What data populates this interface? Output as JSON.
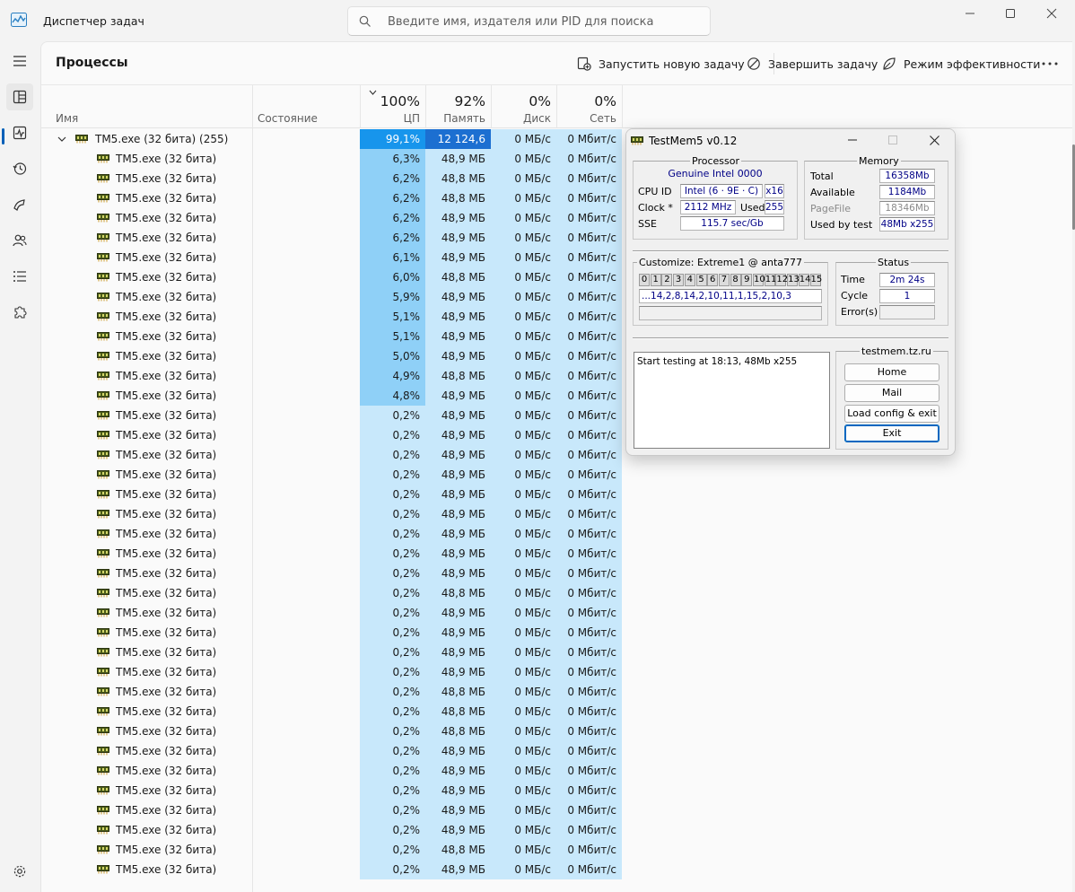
{
  "titlebar": {
    "app_title": "Диспетчер задач",
    "search_placeholder": "Введите имя, издателя или PID для поиска"
  },
  "nav": {
    "items": [
      "menu",
      "processes",
      "performance",
      "app-history",
      "startup-apps",
      "users",
      "details",
      "services"
    ],
    "active": "processes"
  },
  "toolbar": {
    "page_title": "Процессы",
    "run_new_task": "Запустить новую задачу",
    "end_task": "Завершить задачу",
    "efficiency_mode": "Режим эффективности"
  },
  "columns": {
    "name": "Имя",
    "status": "Состояние",
    "cpu_pct": "100%",
    "cpu": "ЦП",
    "mem_pct": "92%",
    "mem": "Память",
    "disk_pct": "0%",
    "disk": "Диск",
    "net_pct": "0%",
    "net": "Сеть"
  },
  "group": {
    "name": "TM5.exe (32 бита) (255)",
    "cpu": "99,1%",
    "mem": "12 124,6 ...",
    "disk": "0 МБ/с",
    "net": "0 Мбит/с"
  },
  "rows": [
    {
      "name": "TM5.exe (32 бита)",
      "cpu": "6,3%",
      "mem": "48,9 МБ",
      "disk": "0 МБ/с",
      "net": "0 Мбит/с"
    },
    {
      "name": "TM5.exe (32 бита)",
      "cpu": "6,2%",
      "mem": "48,8 МБ",
      "disk": "0 МБ/с",
      "net": "0 Мбит/с"
    },
    {
      "name": "TM5.exe (32 бита)",
      "cpu": "6,2%",
      "mem": "48,8 МБ",
      "disk": "0 МБ/с",
      "net": "0 Мбит/с"
    },
    {
      "name": "TM5.exe (32 бита)",
      "cpu": "6,2%",
      "mem": "48,9 МБ",
      "disk": "0 МБ/с",
      "net": "0 Мбит/с"
    },
    {
      "name": "TM5.exe (32 бита)",
      "cpu": "6,2%",
      "mem": "48,9 МБ",
      "disk": "0 МБ/с",
      "net": "0 Мбит/с"
    },
    {
      "name": "TM5.exe (32 бита)",
      "cpu": "6,1%",
      "mem": "48,9 МБ",
      "disk": "0 МБ/с",
      "net": "0 Мбит/с"
    },
    {
      "name": "TM5.exe (32 бита)",
      "cpu": "6,0%",
      "mem": "48,8 МБ",
      "disk": "0 МБ/с",
      "net": "0 Мбит/с"
    },
    {
      "name": "TM5.exe (32 бита)",
      "cpu": "5,9%",
      "mem": "48,9 МБ",
      "disk": "0 МБ/с",
      "net": "0 Мбит/с"
    },
    {
      "name": "TM5.exe (32 бита)",
      "cpu": "5,1%",
      "mem": "48,9 МБ",
      "disk": "0 МБ/с",
      "net": "0 Мбит/с"
    },
    {
      "name": "TM5.exe (32 бита)",
      "cpu": "5,1%",
      "mem": "48,9 МБ",
      "disk": "0 МБ/с",
      "net": "0 Мбит/с"
    },
    {
      "name": "TM5.exe (32 бита)",
      "cpu": "5,0%",
      "mem": "48,9 МБ",
      "disk": "0 МБ/с",
      "net": "0 Мбит/с"
    },
    {
      "name": "TM5.exe (32 бита)",
      "cpu": "4,9%",
      "mem": "48,8 МБ",
      "disk": "0 МБ/с",
      "net": "0 Мбит/с"
    },
    {
      "name": "TM5.exe (32 бита)",
      "cpu": "4,8%",
      "mem": "48,9 МБ",
      "disk": "0 МБ/с",
      "net": "0 Мбит/с"
    },
    {
      "name": "TM5.exe (32 бита)",
      "cpu": "0,2%",
      "mem": "48,9 МБ",
      "disk": "0 МБ/с",
      "net": "0 Мбит/с"
    },
    {
      "name": "TM5.exe (32 бита)",
      "cpu": "0,2%",
      "mem": "48,9 МБ",
      "disk": "0 МБ/с",
      "net": "0 Мбит/с"
    },
    {
      "name": "TM5.exe (32 бита)",
      "cpu": "0,2%",
      "mem": "48,9 МБ",
      "disk": "0 МБ/с",
      "net": "0 Мбит/с"
    },
    {
      "name": "TM5.exe (32 бита)",
      "cpu": "0,2%",
      "mem": "48,9 МБ",
      "disk": "0 МБ/с",
      "net": "0 Мбит/с"
    },
    {
      "name": "TM5.exe (32 бита)",
      "cpu": "0,2%",
      "mem": "48,9 МБ",
      "disk": "0 МБ/с",
      "net": "0 Мбит/с"
    },
    {
      "name": "TM5.exe (32 бита)",
      "cpu": "0,2%",
      "mem": "48,9 МБ",
      "disk": "0 МБ/с",
      "net": "0 Мбит/с"
    },
    {
      "name": "TM5.exe (32 бита)",
      "cpu": "0,2%",
      "mem": "48,9 МБ",
      "disk": "0 МБ/с",
      "net": "0 Мбит/с"
    },
    {
      "name": "TM5.exe (32 бита)",
      "cpu": "0,2%",
      "mem": "48,9 МБ",
      "disk": "0 МБ/с",
      "net": "0 Мбит/с"
    },
    {
      "name": "TM5.exe (32 бита)",
      "cpu": "0,2%",
      "mem": "48,9 МБ",
      "disk": "0 МБ/с",
      "net": "0 Мбит/с"
    },
    {
      "name": "TM5.exe (32 бита)",
      "cpu": "0,2%",
      "mem": "48,8 МБ",
      "disk": "0 МБ/с",
      "net": "0 Мбит/с"
    },
    {
      "name": "TM5.exe (32 бита)",
      "cpu": "0,2%",
      "mem": "48,9 МБ",
      "disk": "0 МБ/с",
      "net": "0 Мбит/с"
    },
    {
      "name": "TM5.exe (32 бита)",
      "cpu": "0,2%",
      "mem": "48,9 МБ",
      "disk": "0 МБ/с",
      "net": "0 Мбит/с"
    },
    {
      "name": "TM5.exe (32 бита)",
      "cpu": "0,2%",
      "mem": "48,9 МБ",
      "disk": "0 МБ/с",
      "net": "0 Мбит/с"
    },
    {
      "name": "TM5.exe (32 бита)",
      "cpu": "0,2%",
      "mem": "48,9 МБ",
      "disk": "0 МБ/с",
      "net": "0 Мбит/с"
    },
    {
      "name": "TM5.exe (32 бита)",
      "cpu": "0,2%",
      "mem": "48,8 МБ",
      "disk": "0 МБ/с",
      "net": "0 Мбит/с"
    },
    {
      "name": "TM5.exe (32 бита)",
      "cpu": "0,2%",
      "mem": "48,8 МБ",
      "disk": "0 МБ/с",
      "net": "0 Мбит/с"
    },
    {
      "name": "TM5.exe (32 бита)",
      "cpu": "0,2%",
      "mem": "48,8 МБ",
      "disk": "0 МБ/с",
      "net": "0 Мбит/с"
    },
    {
      "name": "TM5.exe (32 бита)",
      "cpu": "0,2%",
      "mem": "48,9 МБ",
      "disk": "0 МБ/с",
      "net": "0 Мбит/с"
    },
    {
      "name": "TM5.exe (32 бита)",
      "cpu": "0,2%",
      "mem": "48,9 МБ",
      "disk": "0 МБ/с",
      "net": "0 Мбит/с"
    },
    {
      "name": "TM5.exe (32 бита)",
      "cpu": "0,2%",
      "mem": "48,9 МБ",
      "disk": "0 МБ/с",
      "net": "0 Мбит/с"
    },
    {
      "name": "TM5.exe (32 бита)",
      "cpu": "0,2%",
      "mem": "48,9 МБ",
      "disk": "0 МБ/с",
      "net": "0 Мбит/с"
    },
    {
      "name": "TM5.exe (32 бита)",
      "cpu": "0,2%",
      "mem": "48,9 МБ",
      "disk": "0 МБ/с",
      "net": "0 Мбит/с"
    },
    {
      "name": "TM5.exe (32 бита)",
      "cpu": "0,2%",
      "mem": "48,8 МБ",
      "disk": "0 МБ/с",
      "net": "0 Мбит/с"
    },
    {
      "name": "TM5.exe (32 бита)",
      "cpu": "0,2%",
      "mem": "48,9 МБ",
      "disk": "0 МБ/с",
      "net": "0 Мбит/с"
    }
  ],
  "tm5": {
    "title": "TestMem5 v0.12",
    "processor": {
      "group_label": "Processor",
      "vendor": "Genuine Intel  0000",
      "cpuid_label": "CPU ID",
      "cpuid": "Intel  (6 · 9E · C)",
      "threads": "x16",
      "clock_label": "Clock *",
      "clock": "2112 MHz",
      "used_label": "Used",
      "used": "255",
      "sse_label": "SSE",
      "sse": "115.7 sec/Gb"
    },
    "memory": {
      "group_label": "Memory",
      "total_label": "Total",
      "total": "16358Mb",
      "available_label": "Available",
      "available": "1184Mb",
      "pagefile_label": "PageFile",
      "pagefile": "18346Mb",
      "usedby_label": "Used by test",
      "usedby": "48Mb x255"
    },
    "customize": {
      "label": "Customize: Extreme1 @ anta777",
      "tests": [
        "0",
        "1",
        "2",
        "3",
        "4",
        "5",
        "6",
        "7",
        "8",
        "9",
        "10",
        "11",
        "12",
        "13",
        "14",
        "15"
      ],
      "sequence": "...14,2,8,14,2,10,11,1,15,2,10,3",
      "progress": ""
    },
    "status": {
      "group_label": "Status",
      "time_label": "Time",
      "time": "2m 24s",
      "cycle_label": "Cycle",
      "cycle": "1",
      "errors_label": "Error(s)",
      "errors": ""
    },
    "log": "Start testing at 18:13, 48Mb x255",
    "site": {
      "group_label": "testmem.tz.ru",
      "home": "Home",
      "mail": "Mail",
      "load_config": "Load config & exit",
      "exit": "Exit"
    }
  },
  "colors": {
    "accent": "#005fb8",
    "cpu_hot": "#1795ec",
    "cpu_high": "#8fd0f7",
    "cpu_low": "#c8e8fb",
    "mem_hot": "#1c6fd1",
    "mem_bg": "#c8e8fb"
  }
}
